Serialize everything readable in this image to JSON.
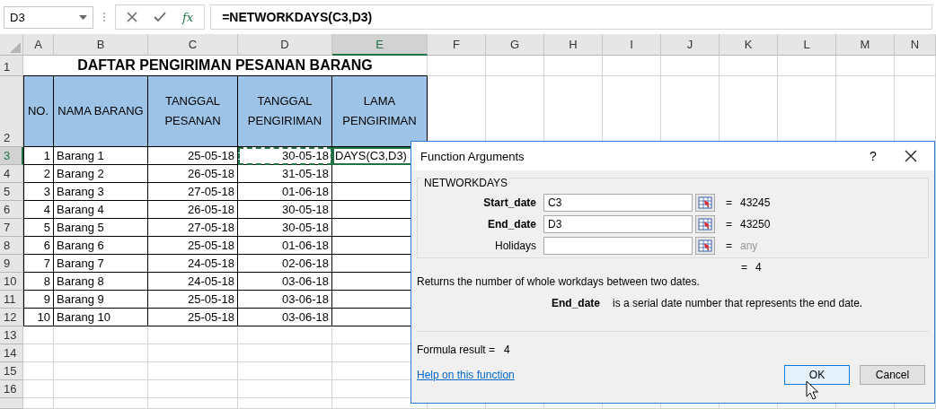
{
  "formula_bar": {
    "name_box": "D3",
    "fx_label": "fx",
    "formula": "=NETWORKDAYS(C3,D3)"
  },
  "columns": [
    {
      "label": "A",
      "selected": false
    },
    {
      "label": "B",
      "selected": false
    },
    {
      "label": "C",
      "selected": false
    },
    {
      "label": "D",
      "selected": false
    },
    {
      "label": "E",
      "selected": true
    },
    {
      "label": "F",
      "selected": false
    },
    {
      "label": "G",
      "selected": false
    },
    {
      "label": "H",
      "selected": false
    },
    {
      "label": "I",
      "selected": false
    },
    {
      "label": "J",
      "selected": false
    },
    {
      "label": "K",
      "selected": false
    },
    {
      "label": "L",
      "selected": false
    },
    {
      "label": "M",
      "selected": false
    },
    {
      "label": "N",
      "selected": false
    }
  ],
  "row_headers": [
    {
      "label": "1",
      "selected": false
    },
    {
      "label": "2",
      "selected": false
    },
    {
      "label": "3",
      "selected": true
    },
    {
      "label": "4",
      "selected": false
    },
    {
      "label": "5",
      "selected": false
    },
    {
      "label": "6",
      "selected": false
    },
    {
      "label": "7",
      "selected": false
    },
    {
      "label": "8",
      "selected": false
    },
    {
      "label": "9",
      "selected": false
    },
    {
      "label": "10",
      "selected": false
    },
    {
      "label": "11",
      "selected": false
    },
    {
      "label": "12",
      "selected": false
    },
    {
      "label": "13",
      "selected": false
    },
    {
      "label": "14",
      "selected": false
    },
    {
      "label": "15",
      "selected": false
    },
    {
      "label": "16",
      "selected": false
    }
  ],
  "sheet": {
    "title": "DAFTAR PENGIRIMAN PESANAN BARANG",
    "headers": [
      "NO.",
      "NAMA BARANG",
      "TANGGAL PESANAN",
      "TANGGAL PENGIRIMAN",
      "LAMA PENGIRIMAN"
    ],
    "rows": [
      {
        "cells": [
          "1",
          "Barang 1",
          "25-05-18",
          "30-05-18",
          "DAYS(C3,D3)"
        ],
        "referenced": true,
        "active": true
      },
      {
        "cells": [
          "2",
          "Barang 2",
          "26-05-18",
          "31-05-18"
        ],
        "referenced": false,
        "active": false
      },
      {
        "cells": [
          "3",
          "Barang 3",
          "27-05-18",
          "01-06-18"
        ],
        "referenced": false,
        "active": false
      },
      {
        "cells": [
          "4",
          "Barang 4",
          "26-05-18",
          "30-05-18"
        ],
        "referenced": false,
        "active": false
      },
      {
        "cells": [
          "5",
          "Barang 5",
          "27-05-18",
          "30-05-18"
        ],
        "referenced": false,
        "active": false
      },
      {
        "cells": [
          "6",
          "Barang 6",
          "25-05-18",
          "01-06-18"
        ],
        "referenced": false,
        "active": false
      },
      {
        "cells": [
          "7",
          "Barang 7",
          "24-05-18",
          "02-06-18"
        ],
        "referenced": false,
        "active": false
      },
      {
        "cells": [
          "8",
          "Barang 8",
          "24-05-18",
          "03-06-18"
        ],
        "referenced": false,
        "active": false
      },
      {
        "cells": [
          "9",
          "Barang 9",
          "25-05-18",
          "03-06-18"
        ],
        "referenced": false,
        "active": false
      },
      {
        "cells": [
          "10",
          "Barang 10",
          "25-05-18",
          "03-06-18"
        ],
        "referenced": false,
        "active": false
      }
    ]
  },
  "dialog": {
    "title": "Function Arguments",
    "help": "?",
    "function_name": "NETWORKDAYS",
    "arguments": [
      {
        "label": "Start_date",
        "value": "C3",
        "sign": "=",
        "result": "43245",
        "required": true
      },
      {
        "label": "End_date",
        "value": "D3",
        "sign": "=",
        "result": "43250",
        "required": true
      },
      {
        "label": "Holidays",
        "sign": "=",
        "result": "any",
        "required": false
      }
    ],
    "total": {
      "sign": "=",
      "value": "4"
    },
    "description": "Returns the number of whole workdays between two dates.",
    "argument_help": {
      "name": "End_date",
      "text": "is a serial date number that represents the end date."
    },
    "formula_result": {
      "label": "Formula result =",
      "value": "4"
    },
    "help_link": "Help on this function",
    "buttons": [
      {
        "label": "OK",
        "selected": true
      },
      {
        "label": "Cancel",
        "selected": false
      }
    ]
  }
}
